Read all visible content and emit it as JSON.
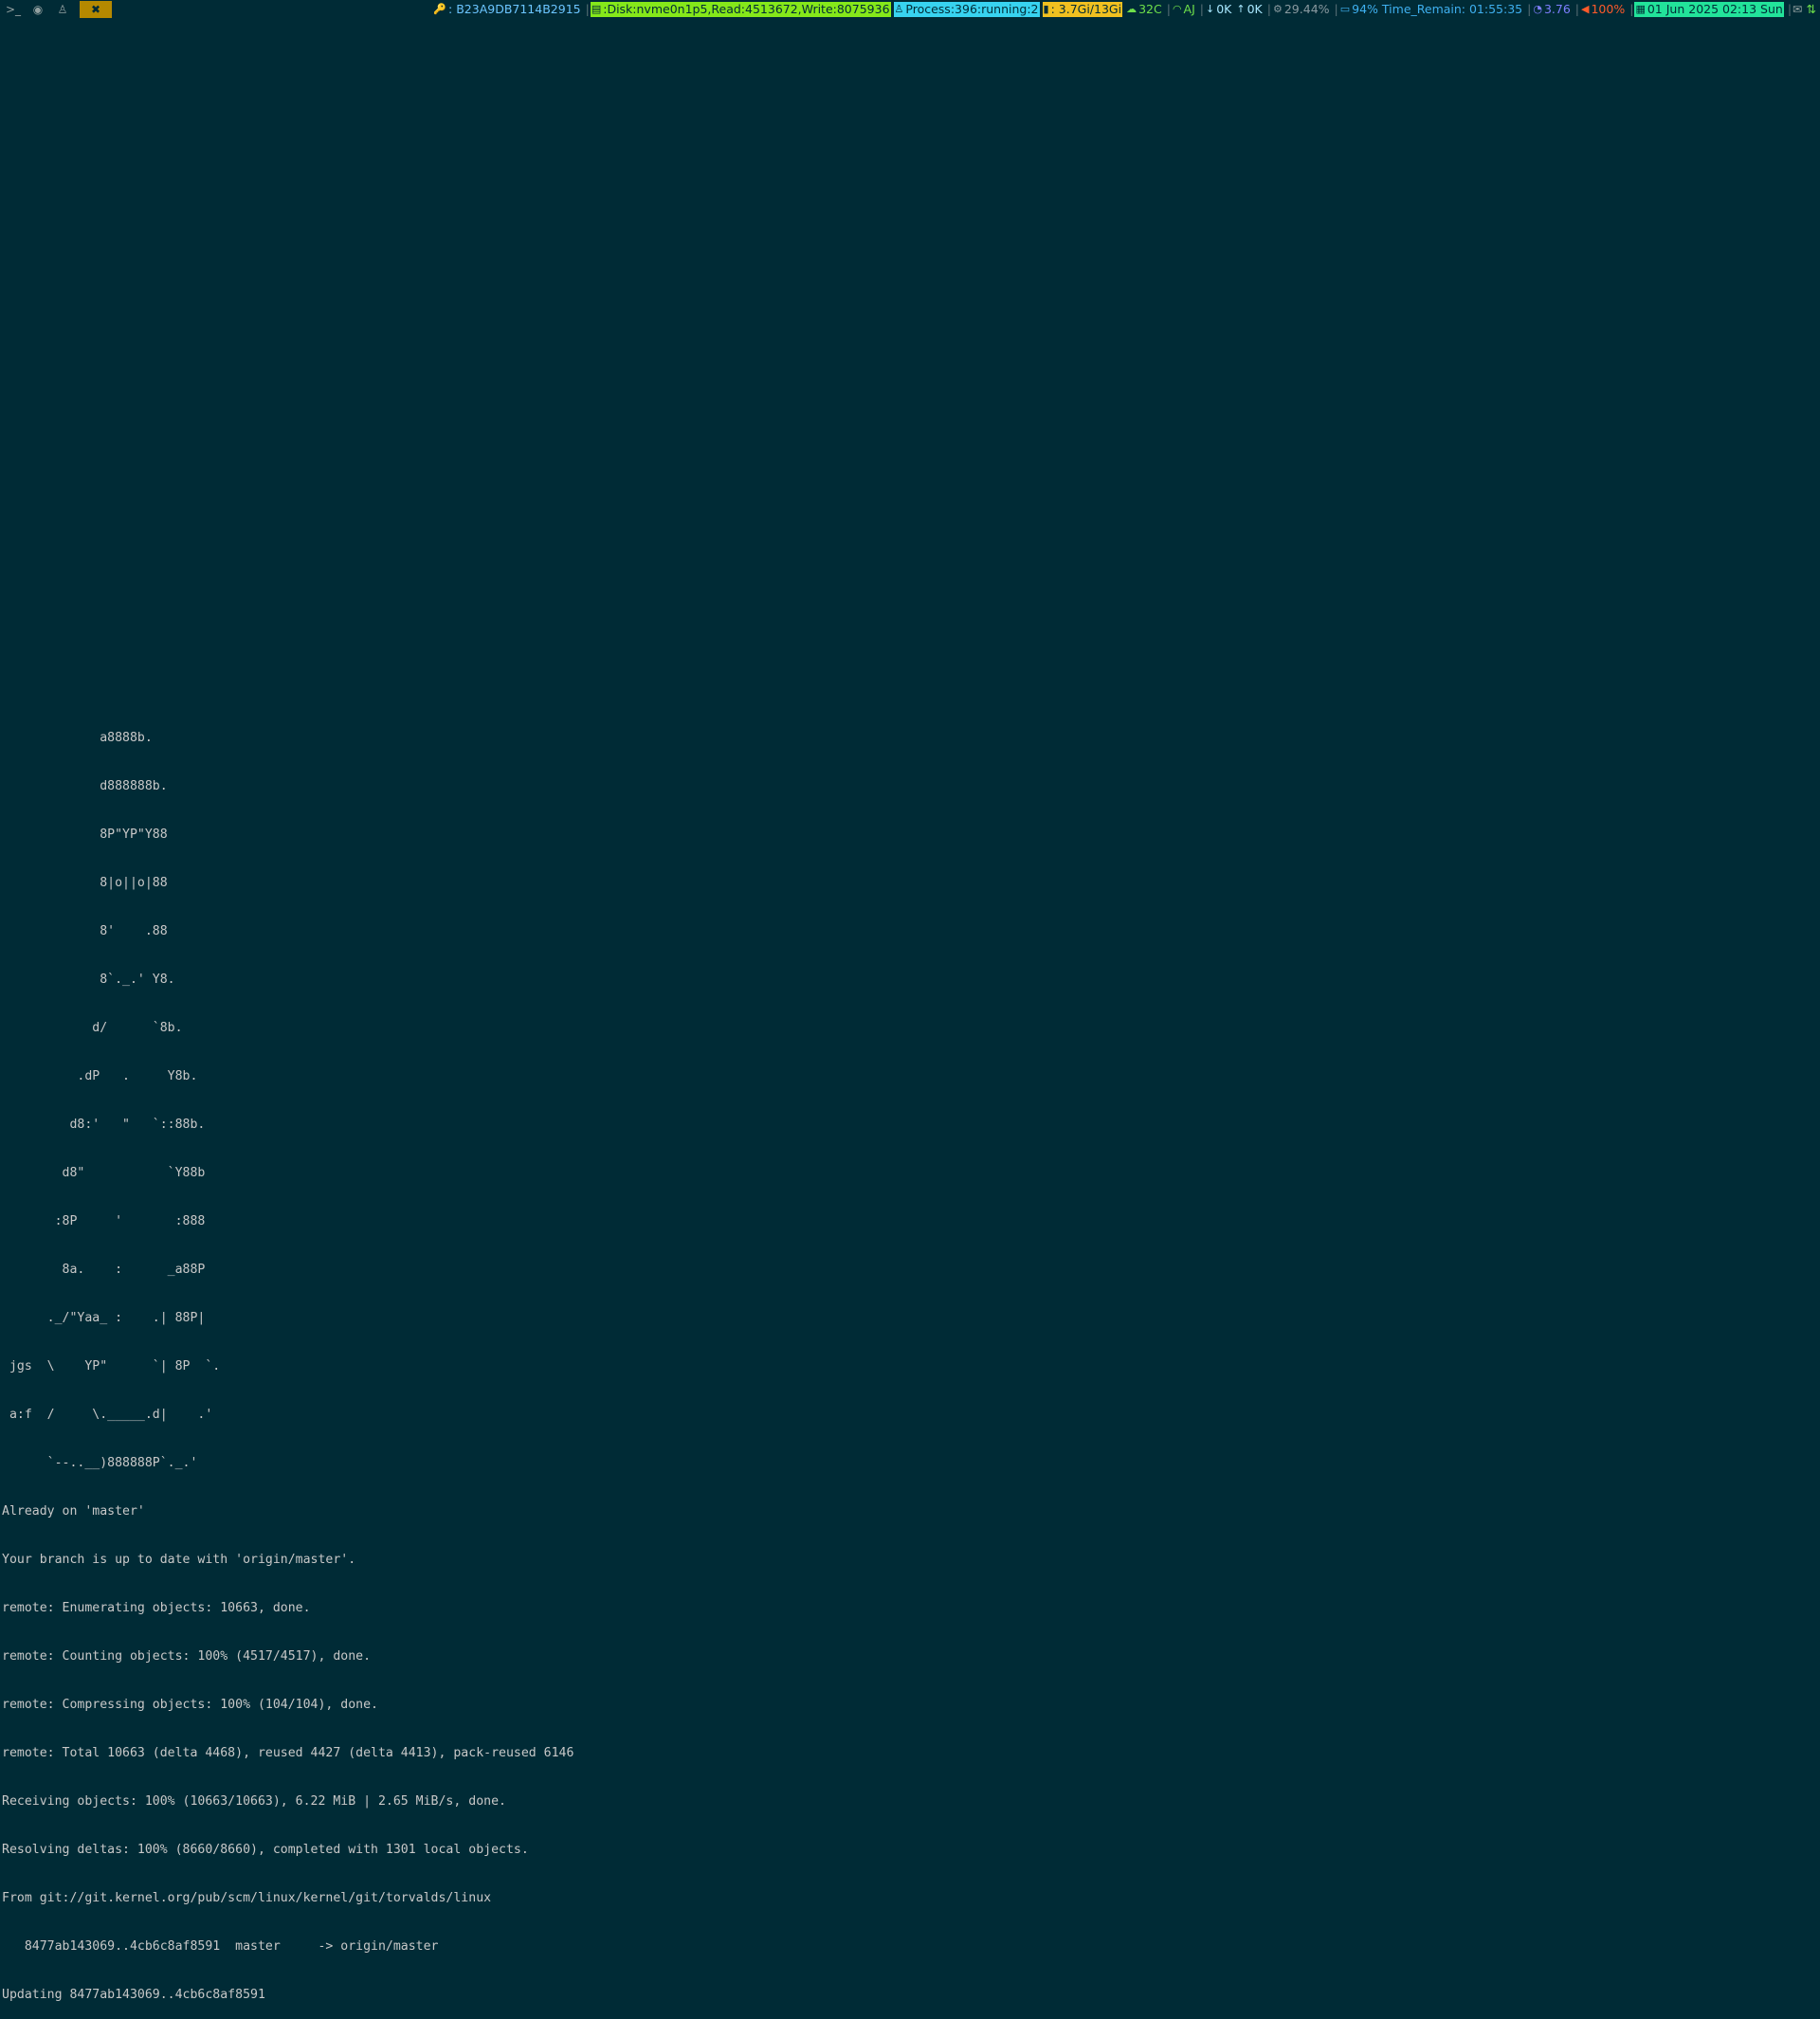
{
  "topbar": {
    "workspaces": [
      {
        "icon": "terminal-icon",
        "glyph": ">_"
      },
      {
        "icon": "browser-icon",
        "glyph": "◉"
      },
      {
        "icon": "linux-icon",
        "glyph": "♙"
      },
      {
        "icon": "tools-icon",
        "glyph": "✖"
      }
    ],
    "key": {
      "icon": "key-icon",
      "text": ": B23A9DB7114B2915"
    },
    "disk": {
      "icon": "disk-icon",
      "text": ":Disk:nvme0n1p5,Read:4513672,Write:8075936"
    },
    "process": {
      "icon": "linux-icon",
      "text": " Process:396:running:2"
    },
    "memory": {
      "icon": "chart-icon",
      "text": " : 3.7Gi/13Gi"
    },
    "temperature": {
      "icon": "cloud-icon",
      "text": " 32C"
    },
    "wifi": {
      "icon": "wifi-icon",
      "text": "AJ"
    },
    "download": {
      "icon": "arrow-down-icon",
      "text": "0K"
    },
    "upload": {
      "icon": "arrow-up-icon",
      "text": "0K"
    },
    "cpu": {
      "icon": "gear-icon",
      "text": "29.44%"
    },
    "battery": {
      "icon": "battery-icon",
      "text": "94% Time_Remain: 01:55:35"
    },
    "load": {
      "icon": "gauge-icon",
      "text": "3.76"
    },
    "volume": {
      "icon": "speaker-icon",
      "text": "100%"
    },
    "date": {
      "icon": "calendar-icon",
      "text": "01 Jun 2025 02:13 Sun"
    },
    "tray": [
      "mail-icon",
      "network-icon"
    ],
    "colors": {
      "background": "#002b36",
      "disk": "#85e81a",
      "process": "#38d3f0",
      "memory": "#f0c020",
      "date": "#22e39a",
      "volume": "#ff5a2a",
      "active_workspace": "#b58900"
    }
  },
  "terminal": {
    "lines": [
      "             a8888b.",
      "             d888888b.",
      "             8P\"YP\"Y88",
      "             8|o||o|88",
      "             8'    .88",
      "             8`._.' Y8.",
      "            d/      `8b.",
      "          .dP   .     Y8b.",
      "         d8:'   \"   `::88b.",
      "        d8\"           `Y88b",
      "       :8P     '       :888",
      "        8a.    :      _a88P",
      "      ._/\"Yaa_ :    .| 88P|",
      " jgs  \\    YP\"      `| 8P  `.",
      " a:f  /     \\._____.d|    .'",
      "      `--..__)888888P`._.'",
      "Already on 'master'",
      "Your branch is up to date with 'origin/master'.",
      "remote: Enumerating objects: 10663, done.",
      "remote: Counting objects: 100% (4517/4517), done.",
      "remote: Compressing objects: 100% (104/104), done.",
      "remote: Total 10663 (delta 4468), reused 4427 (delta 4413), pack-reused 6146",
      "Receiving objects: 100% (10663/10663), 6.22 MiB | 2.65 MiB/s, done.",
      "Resolving deltas: 100% (8660/8660), completed with 1301 local objects.",
      "From git://git.kernel.org/pub/scm/linux/kernel/git/torvalds/linux",
      "   8477ab143069..4cb6c8af8591  master     -> origin/master",
      "Updating 8477ab143069..4cb6c8af8591"
    ]
  }
}
